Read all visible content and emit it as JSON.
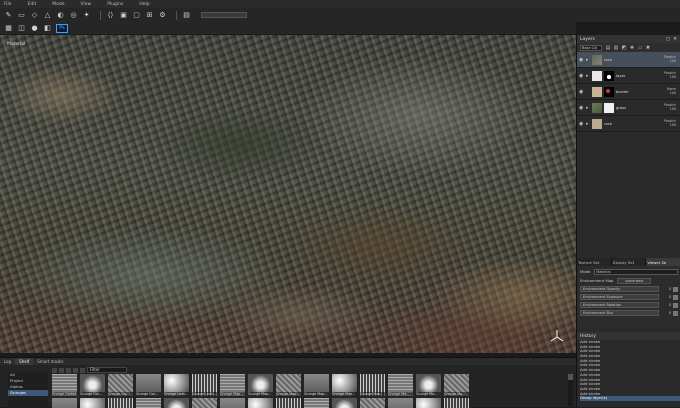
{
  "menu": [
    "File",
    "Edit",
    "Mode",
    "View",
    "Plugins",
    "Help"
  ],
  "viewport": {
    "label": "Material"
  },
  "layers": {
    "title": "Layers",
    "blend_select": "Base Col",
    "rows": [
      {
        "name": "rock",
        "blend": "Passthr",
        "opacity": "100",
        "selected": true
      },
      {
        "name": "layer",
        "blend": "Passthr",
        "opacity": "100"
      },
      {
        "name": "border",
        "blend": "Norm",
        "opacity": "100"
      },
      {
        "name": "grass",
        "blend": "Passthr",
        "opacity": "100"
      },
      {
        "name": "rock",
        "blend": "Passthr",
        "opacity": "100"
      }
    ]
  },
  "tabs": [
    "Texture Set",
    "Display Set",
    "Viewer Se"
  ],
  "viewer": {
    "mode_label": "Mode",
    "mode_value": "Material",
    "env_map_label": "Environment Map",
    "env_map_value": "panorama",
    "sliders": [
      {
        "label": "Environment Opacity",
        "value": "0"
      },
      {
        "label": "Environment Exposure",
        "value": "0"
      },
      {
        "label": "Environment Rotation",
        "value": "0"
      },
      {
        "label": "Environment Blur",
        "value": "0"
      }
    ]
  },
  "history": {
    "title": "History",
    "items": [
      "Add stroke",
      "Add stroke",
      "Add stroke",
      "Add stroke",
      "Add stroke",
      "Add stroke",
      "Add stroke",
      "Add stroke",
      "Add stroke",
      "Add stroke",
      "Add stroke",
      "Add stroke",
      "Group layer(s)"
    ],
    "selected_index": 12
  },
  "bottom": {
    "tabs": [
      "Log",
      "Shelf",
      "Smart masks"
    ],
    "filter_label": "Filter",
    "categories": [
      "All",
      "Project",
      "Alphas",
      "Grunges"
    ],
    "selected_category": 3,
    "items": [
      "Grunge Folded",
      "Grunge Gal...",
      "Grunge Gal...",
      "Grunge Gal...",
      "Grunge Leak...",
      "Grunge Leak...",
      "Grunge Map...",
      "Grunge Map...",
      "Grunge Map...",
      "Grunge Map...",
      "Grunge Map...",
      "Grunge Map...",
      "Grunge Ma...",
      "Grunge Ma...",
      "Grunge Ma..."
    ]
  }
}
